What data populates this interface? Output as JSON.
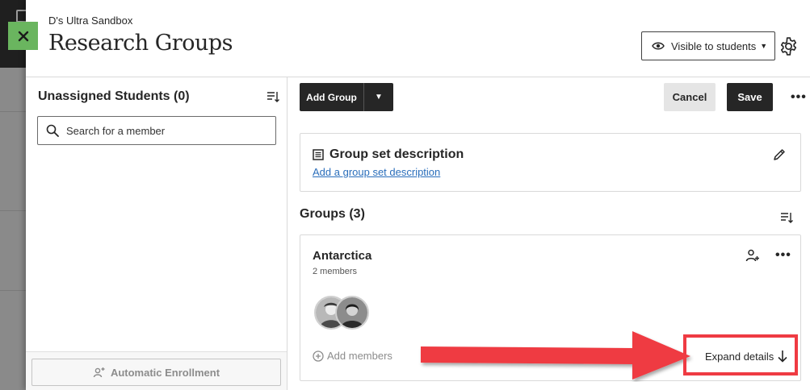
{
  "header": {
    "course_name": "D's Ultra Sandbox",
    "title": "Research Groups",
    "visibility_label": "Visible to students"
  },
  "left_panel": {
    "title": "Unassigned Students (0)",
    "search_placeholder": "Search for a member",
    "auto_enrollment_label": "Automatic Enrollment"
  },
  "toolbar": {
    "add_group_label": "Add Group",
    "cancel_label": "Cancel",
    "save_label": "Save"
  },
  "description_card": {
    "title": "Group set description",
    "link": "Add a group set description"
  },
  "groups": {
    "title": "Groups (3)",
    "items": [
      {
        "name": "Antarctica",
        "member_count": "2 members",
        "add_members_label": "Add members",
        "expand_label": "Expand details"
      }
    ]
  },
  "colors": {
    "close_button": "#6ab55f",
    "primary_dark": "#262626",
    "link": "#2a6ebb",
    "annotation_red": "#ef3b43"
  },
  "icons": [
    "home-icon",
    "close-icon",
    "eye-icon",
    "gear-icon",
    "sort-icon",
    "search-icon",
    "user-plus-icon",
    "chevron-down-icon",
    "document-icon",
    "pencil-icon",
    "add-person-icon",
    "more-icon",
    "plus-circle-icon",
    "arrow-down-icon"
  ]
}
